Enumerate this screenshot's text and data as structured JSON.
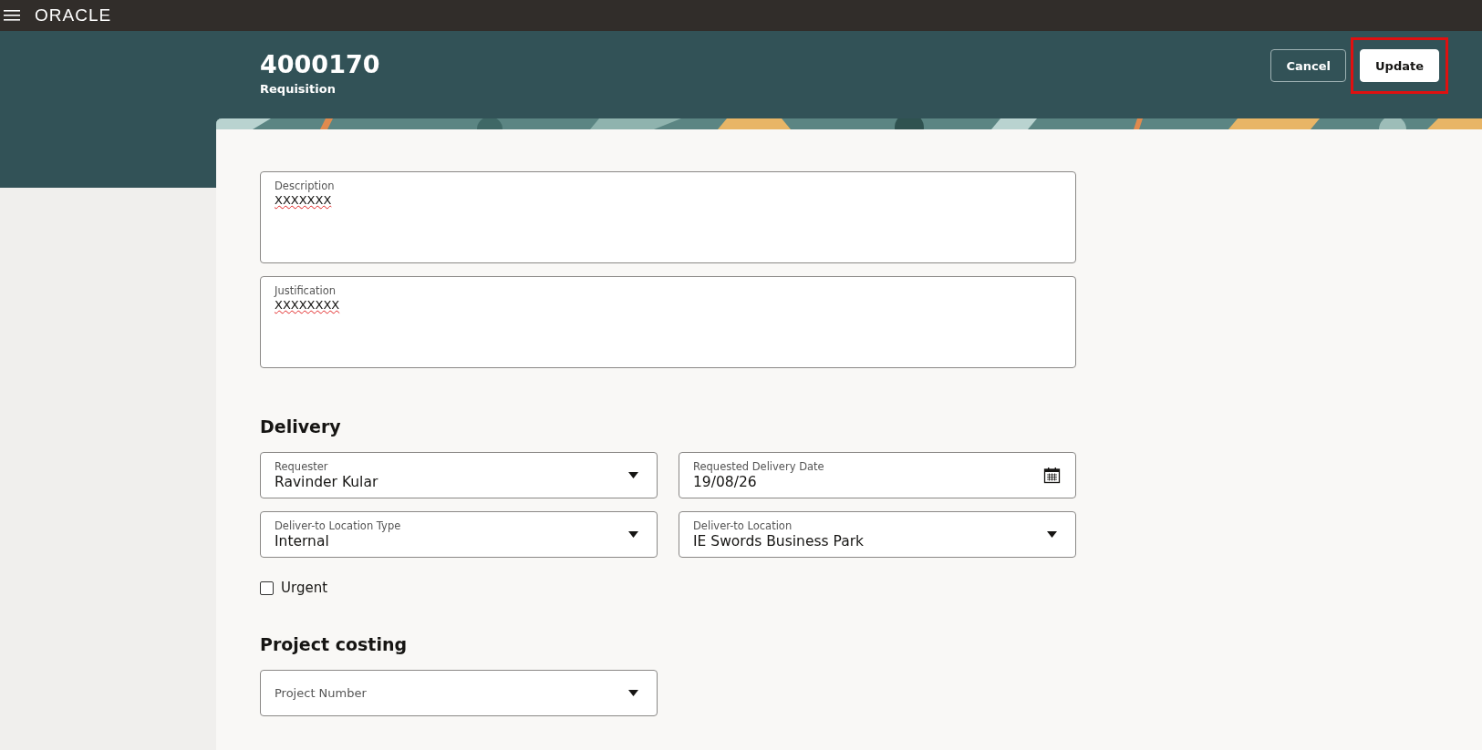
{
  "top_bar": {
    "logo": "ORACLE"
  },
  "header": {
    "title": "4000170",
    "subtitle": "Requisition"
  },
  "buttons": [
    {
      "label": "Cancel",
      "kind": "outline",
      "highlighted": false
    },
    {
      "label": "Update",
      "kind": "solid",
      "highlighted": true
    }
  ],
  "notes": [
    {
      "label": "Description",
      "value": "XXXXXXX",
      "misspelled": true
    },
    {
      "label": "Justification",
      "value": "XXXXXXXX",
      "misspelled": true
    }
  ],
  "sections": [
    {
      "title": "Delivery",
      "fields": [
        {
          "kind": "select",
          "label": "Requester",
          "value": "Ravinder Kular"
        },
        {
          "kind": "date",
          "label": "Requested Delivery Date",
          "value": "19/08/26"
        },
        {
          "kind": "select",
          "label": "Deliver-to Location Type",
          "value": "Internal"
        },
        {
          "kind": "select",
          "label": "Deliver-to Location",
          "value": "IE Swords Business Park"
        }
      ],
      "checkboxes": [
        {
          "label": "Urgent",
          "checked": false
        }
      ]
    },
    {
      "title": "Project costing",
      "fields": [
        {
          "kind": "select",
          "placeholder": "Project Number"
        }
      ]
    }
  ]
}
